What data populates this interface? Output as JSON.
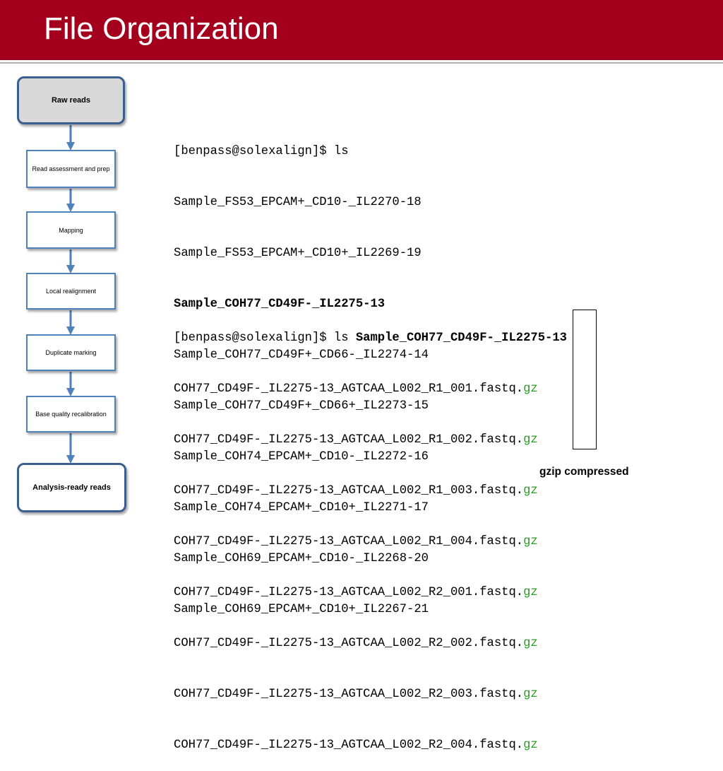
{
  "slide": {
    "title": "File Organization"
  },
  "flowchart": {
    "steps": [
      {
        "label": "Raw reads"
      },
      {
        "label": "Read assessment and prep"
      },
      {
        "label": "Mapping"
      },
      {
        "label": "Local realignment"
      },
      {
        "label": "Duplicate marking"
      },
      {
        "label": "Base quality recalibration"
      },
      {
        "label": "Analysis-ready reads"
      }
    ]
  },
  "terminal": {
    "command1": "[benpass@solexalign]$ ls",
    "listing": [
      "Sample_FS53_EPCAM+_CD10-_IL2270-18",
      "Sample_FS53_EPCAM+_CD10+_IL2269-19",
      "Sample_COH77_CD49F-_IL2275-13",
      "Sample_COH77_CD49F+_CD66-_IL2274-14",
      "Sample_COH77_CD49F+_CD66+_IL2273-15",
      "Sample_COH74_EPCAM+_CD10-_IL2272-16",
      "Sample_COH74_EPCAM+_CD10+_IL2271-17",
      "Sample_COH69_EPCAM+_CD10-_IL2268-20",
      "Sample_COH69_EPCAM+_CD10+_IL2267-21"
    ],
    "highlighted_index": 2,
    "command2_prefix": "[benpass@solexalign]$ ls ",
    "command2_arg": "Sample_COH77_CD49F-_IL2275-13",
    "files": [
      "COH77_CD49F-_IL2275-13_AGTCAA_L002_R1_001.fastq.",
      "COH77_CD49F-_IL2275-13_AGTCAA_L002_R1_002.fastq.",
      "COH77_CD49F-_IL2275-13_AGTCAA_L002_R1_003.fastq.",
      "COH77_CD49F-_IL2275-13_AGTCAA_L002_R1_004.fastq.",
      "COH77_CD49F-_IL2275-13_AGTCAA_L002_R2_001.fastq.",
      "COH77_CD49F-_IL2275-13_AGTCAA_L002_R2_002.fastq.",
      "COH77_CD49F-_IL2275-13_AGTCAA_L002_R2_003.fastq.",
      "COH77_CD49F-_IL2275-13_AGTCAA_L002_R2_004.fastq."
    ],
    "extension": "gz",
    "extension_color": "#27a027"
  },
  "annotation": {
    "label": "gzip compressed"
  },
  "colors": {
    "header": "#a4001e",
    "node_border": "#4f81bd",
    "terminal_node_fill": "#d9d9d9"
  }
}
